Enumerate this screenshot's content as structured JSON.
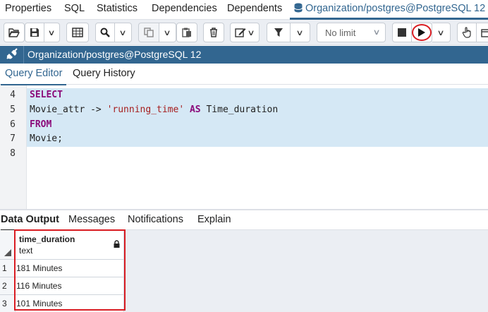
{
  "top_tabs": [
    "Properties",
    "SQL",
    "Statistics",
    "Dependencies",
    "Dependents"
  ],
  "active_tab": {
    "label": "Organization/postgres@PostgreSQL 12 *",
    "icon": "database-icon"
  },
  "toolbar": {
    "limit_label": "No limit"
  },
  "connection": {
    "title": "Organization/postgres@PostgreSQL 12",
    "icon": "plug-icon"
  },
  "editor_tabs": [
    "Query Editor",
    "Query History"
  ],
  "editor": {
    "line_numbers": [
      "4",
      "5",
      "6",
      "7",
      "8"
    ],
    "lines": {
      "l4_kw": "SELECT",
      "l5_a": "Movie_attr -> ",
      "l5_str": "'running_time'",
      "l5_b": " ",
      "l5_kw": "AS",
      "l5_c": " Time_duration",
      "l6_kw": "FROM",
      "l7": "Movie;"
    }
  },
  "output_tabs": [
    "Data Output",
    "Messages",
    "Notifications",
    "Explain"
  ],
  "result": {
    "column": {
      "name": "time_duration",
      "type": "text"
    },
    "rows": [
      {
        "num": "1",
        "value": "181 Minutes"
      },
      {
        "num": "2",
        "value": "116 Minutes"
      },
      {
        "num": "3",
        "value": "101 Minutes"
      }
    ]
  },
  "colors": {
    "accent": "#326690",
    "keyword": "#8b0a7a",
    "string": "#a61e1e",
    "annotation": "#d91c22"
  }
}
